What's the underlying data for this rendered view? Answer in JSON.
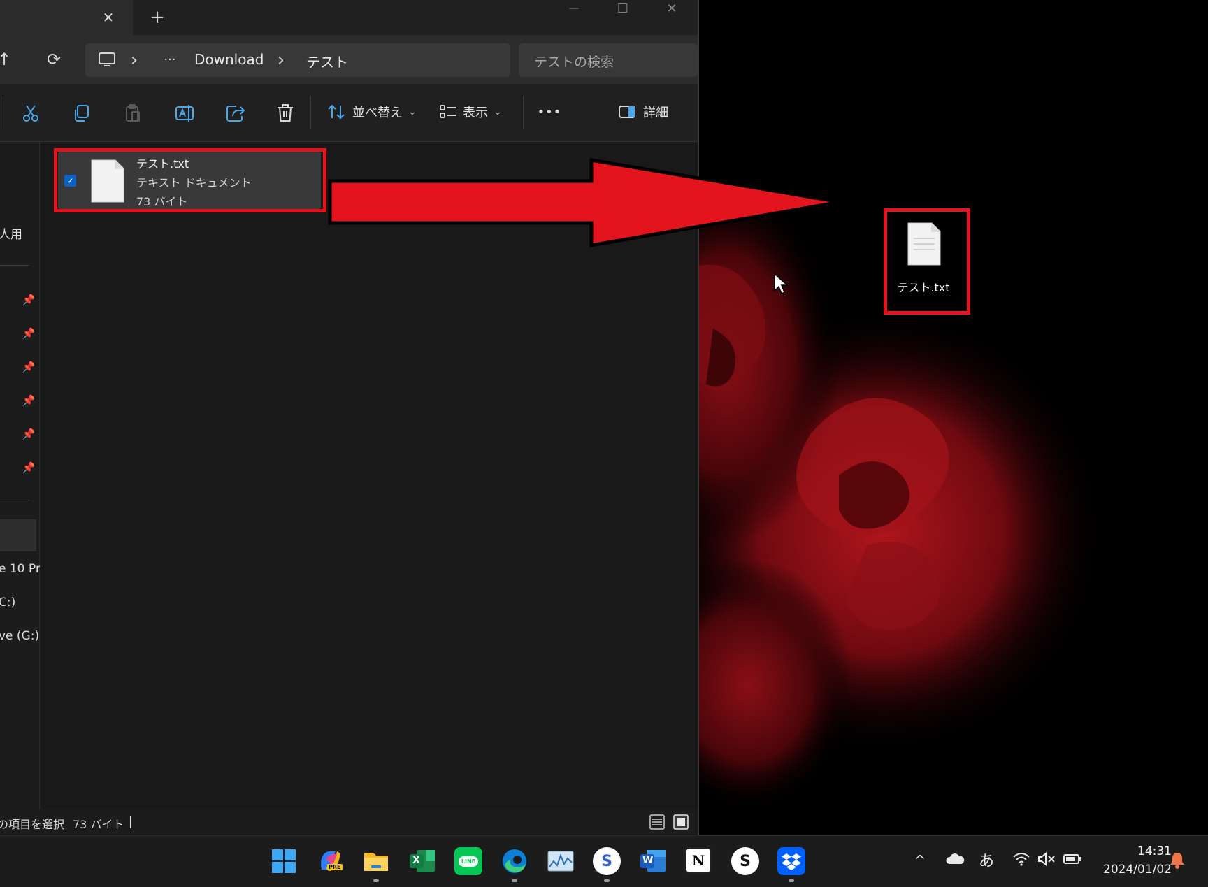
{
  "window": {
    "tab_close_glyph": "✕",
    "new_tab_glyph": "+",
    "minimize_glyph": "—",
    "maximize_glyph": "☐",
    "close_glyph": "✕"
  },
  "address": {
    "up_glyph": "↑",
    "refresh_glyph": "⟳",
    "chevron": "›",
    "more_glyph": "···",
    "crumbs": [
      "Download",
      "テスト"
    ],
    "search_placeholder": "テストの検索"
  },
  "toolbar": {
    "sort_label": "並べ替え",
    "view_label": "表示",
    "more_glyph": "•••",
    "details_label": "詳細",
    "dropdown_glyph": "⌄"
  },
  "nav": {
    "items_text": [
      "人用",
      "e 10 Pr",
      "C:)",
      "ve (G:)"
    ]
  },
  "file": {
    "name": "テスト.txt",
    "type": "テキスト ドキュメント",
    "size": "73 バイト",
    "check_glyph": "✓"
  },
  "status": {
    "selection": "の項目を選択",
    "size": "73 バイト"
  },
  "desktop": {
    "file_name": "テスト.txt"
  },
  "taskbar": {
    "apps": [
      {
        "id": "start",
        "label": ""
      },
      {
        "id": "copilot",
        "label": "PRE"
      },
      {
        "id": "file-explorer",
        "label": ""
      },
      {
        "id": "excel",
        "label": "X"
      },
      {
        "id": "line",
        "label": "LINE"
      },
      {
        "id": "edge",
        "label": ""
      },
      {
        "id": "resource-monitor",
        "label": ""
      },
      {
        "id": "simplenote",
        "label": "S"
      },
      {
        "id": "word",
        "label": "W"
      },
      {
        "id": "notion",
        "label": "N"
      },
      {
        "id": "skype",
        "label": "S"
      },
      {
        "id": "dropbox",
        "label": ""
      }
    ],
    "tray": {
      "chevron_glyph": "^",
      "ime": "あ",
      "mute_glyph": "🔇",
      "time": "14:31",
      "date": "2024/01/02",
      "bell_glyph": "🔔"
    }
  },
  "colors": {
    "highlight_red": "#e3141e",
    "accent_blue": "#0a63c4",
    "selection_bg": "#393939"
  }
}
